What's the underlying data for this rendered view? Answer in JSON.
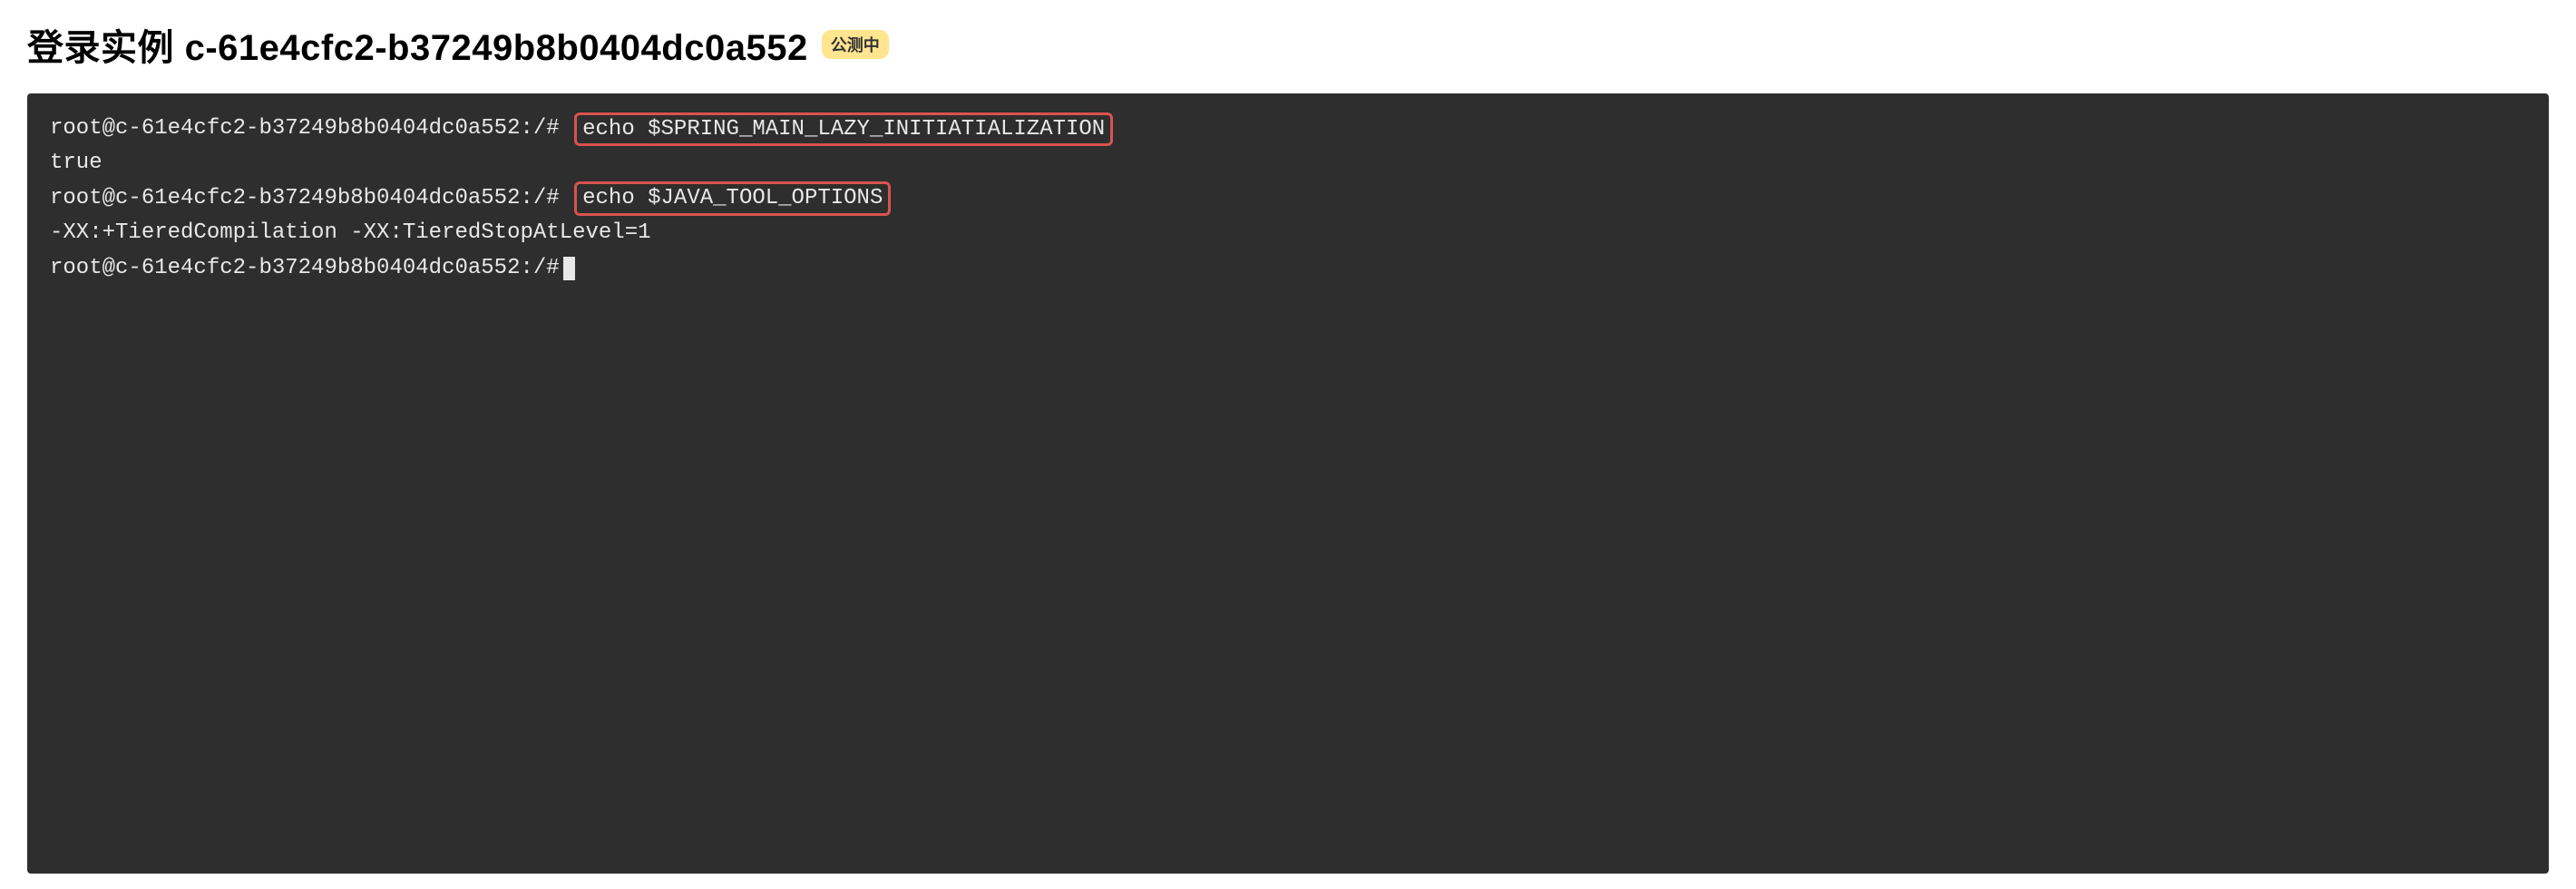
{
  "header": {
    "title": "登录实例 c-61e4cfc2-b37249b8b0404dc0a552",
    "badge": "公测中"
  },
  "terminal": {
    "lines": [
      {
        "prompt": "root@c-61e4cfc2-b37249b8b0404dc0a552:/#",
        "command": "echo $SPRING_MAIN_LAZY_INITIATIALIZATION",
        "highlighted": true
      },
      {
        "output": "true"
      },
      {
        "prompt": "root@c-61e4cfc2-b37249b8b0404dc0a552:/#",
        "command": "echo $JAVA_TOOL_OPTIONS",
        "highlighted": true
      },
      {
        "output": "-XX:+TieredCompilation -XX:TieredStopAtLevel=1"
      },
      {
        "prompt": "root@c-61e4cfc2-b37249b8b0404dc0a552:/#",
        "cursor": true
      }
    ]
  }
}
